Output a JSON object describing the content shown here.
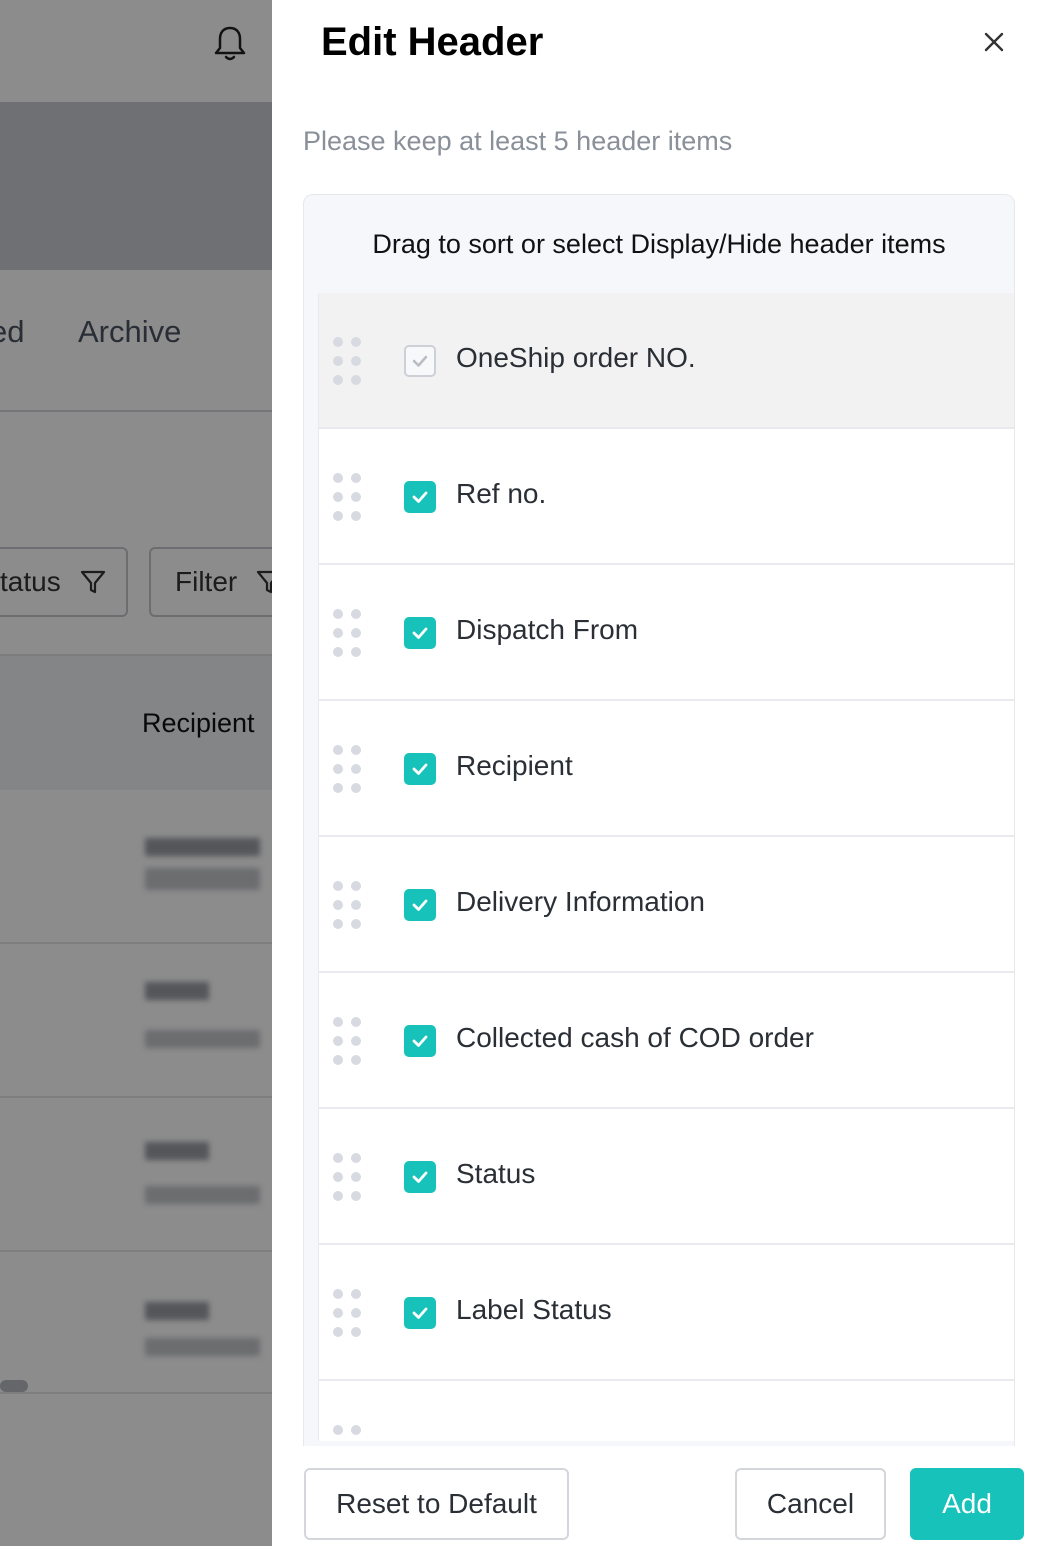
{
  "background": {
    "tabs": [
      "ed",
      "Archive"
    ],
    "filters": {
      "status_label": "tatus",
      "filter_label": "Filter"
    },
    "table_header": "Recipient"
  },
  "drawer": {
    "title": "Edit Header",
    "hint": "Please keep at least 5 header items",
    "instruction": "Drag to sort or select Display/Hide header items",
    "items": [
      {
        "label": "OneShip order NO.",
        "checked": true,
        "disabled": true
      },
      {
        "label": "Ref no.",
        "checked": true,
        "disabled": false
      },
      {
        "label": "Dispatch From",
        "checked": true,
        "disabled": false
      },
      {
        "label": "Recipient",
        "checked": true,
        "disabled": false
      },
      {
        "label": "Delivery Information",
        "checked": true,
        "disabled": false
      },
      {
        "label": "Collected cash of COD order",
        "checked": true,
        "disabled": false
      },
      {
        "label": "Status",
        "checked": true,
        "disabled": false
      },
      {
        "label": "Label Status",
        "checked": true,
        "disabled": false
      }
    ],
    "buttons": {
      "reset": "Reset to Default",
      "cancel": "Cancel",
      "add": "Add"
    }
  },
  "colors": {
    "accent": "#16c2b9",
    "overlay": "rgba(0,0,0,0.45)",
    "hint_text": "#8a9099"
  },
  "icons": {
    "close": "close-icon",
    "notification": "bell-icon",
    "filter": "filter-icon",
    "drag": "drag-handle-icon",
    "check": "check-icon"
  }
}
